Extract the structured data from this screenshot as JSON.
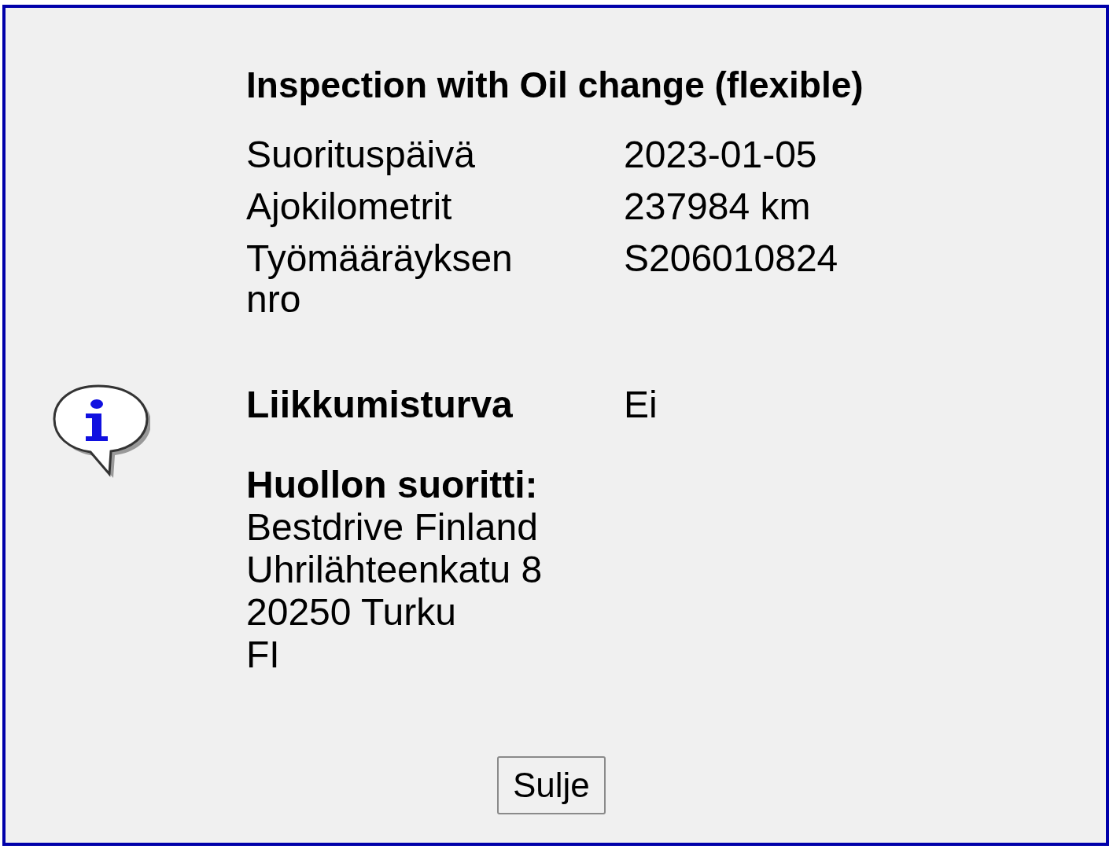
{
  "dialog": {
    "title": "Inspection with Oil change (flexible)",
    "rows": [
      {
        "kind": "plain",
        "label": "Suorituspäivä",
        "value": "2023-01-05"
      },
      {
        "kind": "plain",
        "label": "Ajokilometrit",
        "value": "237984 km"
      },
      {
        "kind": "plain",
        "label": "Työmääräyksen nro",
        "value": "S206010824"
      },
      {
        "kind": "bold",
        "label": "Liikkumisturva",
        "value": "Ei"
      }
    ],
    "performer": {
      "heading": "Huollon suoritti:",
      "lines": [
        "Bestdrive Finland",
        "Uhrilähteenkatu 8",
        "20250 Turku",
        "FI"
      ]
    },
    "button": "Sulje"
  }
}
